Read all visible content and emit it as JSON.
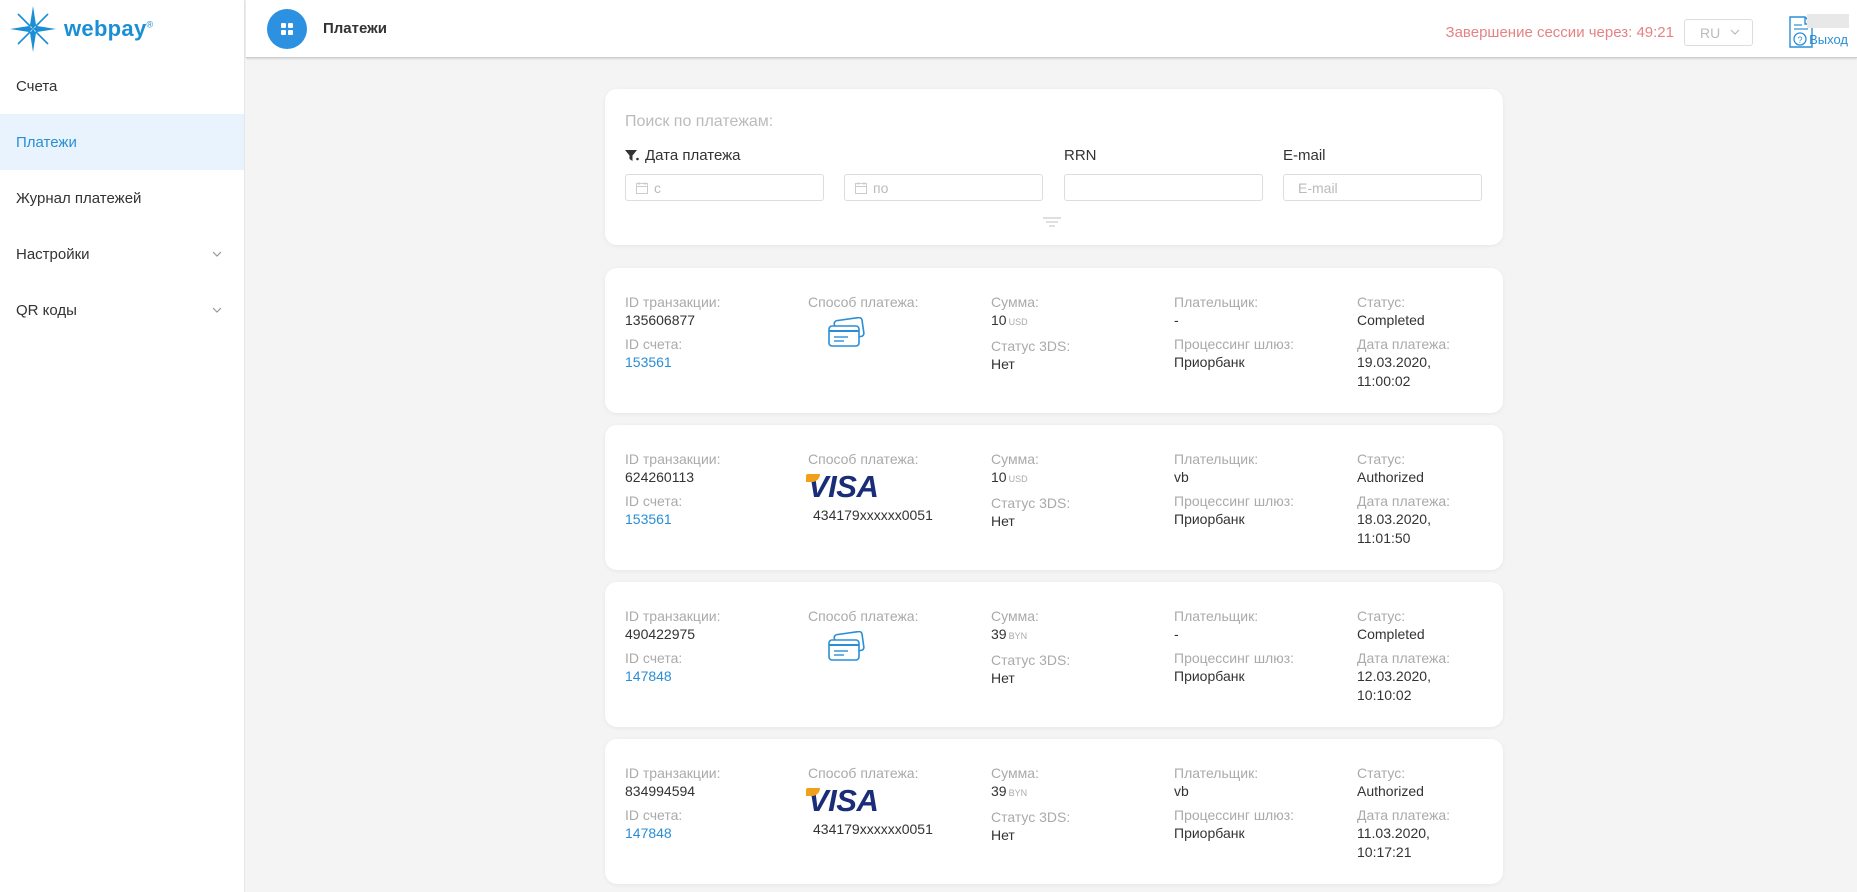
{
  "brand": {
    "logo_text": "webpay",
    "logo_mark": "®",
    "accent": "#2d91e2"
  },
  "sidebar": {
    "items": [
      {
        "label": "Счета",
        "active": false,
        "expandable": false
      },
      {
        "label": "Платежи",
        "active": true,
        "expandable": false
      },
      {
        "label": "Журнал платежей",
        "active": false,
        "expandable": false
      },
      {
        "label": "Настройки",
        "active": false,
        "expandable": true
      },
      {
        "label": "QR коды",
        "active": false,
        "expandable": true
      }
    ]
  },
  "header": {
    "title": "Платежи",
    "session_text": "Завершение сессии через: 49:21",
    "language": "RU",
    "logout_label": "Выход"
  },
  "search": {
    "title": "Поиск по платежам:",
    "date_label": "Дата платежа",
    "date_from_placeholder": "с",
    "date_to_placeholder": "по",
    "rrn_label": "RRN",
    "rrn_value": "",
    "email_label": "E-mail",
    "email_placeholder": "E-mail"
  },
  "labels": {
    "transaction_id": "ID транзакции:",
    "invoice_id": "ID счета:",
    "payment_method": "Способ платежа:",
    "amount": "Сумма:",
    "status_3ds": "Статус 3DS:",
    "payer": "Плательщик:",
    "processing_gateway": "Процессинг шлюз:",
    "status": "Статус:",
    "payment_date": "Дата платежа:"
  },
  "transactions": [
    {
      "transaction_id": "135606877",
      "invoice_id": "153561",
      "method": "card-generic",
      "card_number": "",
      "amount": "10",
      "currency": "USD",
      "status_3ds": "Нет",
      "payer": "-",
      "gateway": "Приорбанк",
      "status": "Completed",
      "date": "19.03.2020,",
      "time": "11:00:02"
    },
    {
      "transaction_id": "624260113",
      "invoice_id": "153561",
      "method": "visa",
      "card_number": "434179xxxxxx0051",
      "amount": "10",
      "currency": "USD",
      "status_3ds": "Нет",
      "payer": "vb",
      "gateway": "Приорбанк",
      "status": "Authorized",
      "date": "18.03.2020,",
      "time": "11:01:50"
    },
    {
      "transaction_id": "490422975",
      "invoice_id": "147848",
      "method": "card-generic",
      "card_number": "",
      "amount": "39",
      "currency": "BYN",
      "status_3ds": "Нет",
      "payer": "-",
      "gateway": "Приорбанк",
      "status": "Completed",
      "date": "12.03.2020,",
      "time": "10:10:02"
    },
    {
      "transaction_id": "834994594",
      "invoice_id": "147848",
      "method": "visa",
      "card_number": "434179xxxxxx0051",
      "amount": "39",
      "currency": "BYN",
      "status_3ds": "Нет",
      "payer": "vb",
      "gateway": "Приорбанк",
      "status": "Authorized",
      "date": "11.03.2020,",
      "time": "10:17:21"
    }
  ],
  "visa_label": "VISA"
}
